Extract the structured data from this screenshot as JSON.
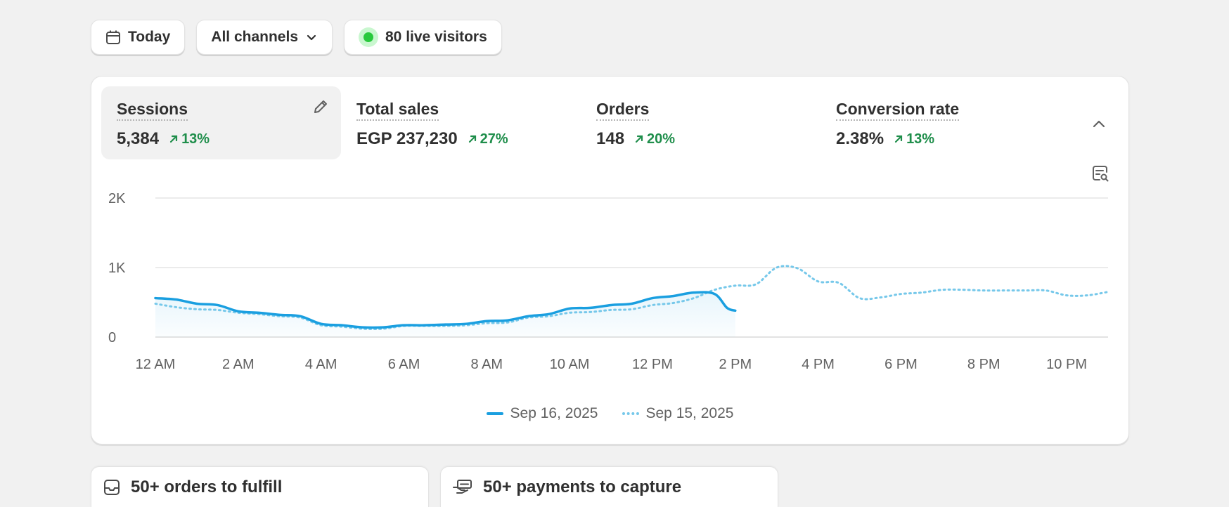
{
  "filters": {
    "date_label": "Today",
    "channel_label": "All channels",
    "live_visitors_label": "80 live visitors"
  },
  "metrics": [
    {
      "label": "Sessions",
      "value": "5,384",
      "change": "13%"
    },
    {
      "label": "Total sales",
      "value": "EGP 237,230",
      "change": "27%"
    },
    {
      "label": "Orders",
      "value": "148",
      "change": "20%"
    },
    {
      "label": "Conversion rate",
      "value": "2.38%",
      "change": "13%"
    }
  ],
  "colors": {
    "accent": "#1a9fe0",
    "comparison": "#76c8ea",
    "positive": "#1f8e4b",
    "live": "#29c93d"
  },
  "chart_data": {
    "type": "line",
    "y_ticks": [
      "2K",
      "1K",
      "0"
    ],
    "ylim": [
      0,
      2000
    ],
    "x_ticks": [
      "12 AM",
      "2 AM",
      "4 AM",
      "6 AM",
      "8 AM",
      "10 AM",
      "12 PM",
      "2 PM",
      "4 PM",
      "6 PM",
      "8 PM",
      "10 PM"
    ],
    "xlim": [
      0,
      23
    ],
    "grid": true,
    "legend_position": "bottom-center",
    "series": [
      {
        "name": "Sep 16, 2025",
        "style": "solid",
        "x": [
          0,
          0.5,
          1,
          1.5,
          2,
          2.5,
          3,
          3.5,
          4,
          4.5,
          5,
          5.5,
          6,
          6.5,
          7,
          7.5,
          8,
          8.5,
          9,
          9.5,
          10,
          10.5,
          11,
          11.5,
          12,
          12.5,
          13,
          13.5,
          13.8,
          14
        ],
        "values": [
          560,
          540,
          480,
          460,
          370,
          350,
          320,
          300,
          190,
          170,
          140,
          140,
          170,
          170,
          180,
          190,
          230,
          240,
          300,
          330,
          410,
          420,
          460,
          480,
          560,
          590,
          640,
          620,
          420,
          380
        ]
      },
      {
        "name": "Sep 15, 2025",
        "style": "dotted",
        "x": [
          0,
          0.5,
          1,
          1.5,
          2,
          2.5,
          3,
          3.5,
          4,
          4.5,
          5,
          5.5,
          6,
          6.5,
          7,
          7.5,
          8,
          8.5,
          9,
          9.5,
          10,
          10.5,
          11,
          11.5,
          12,
          12.5,
          13,
          13.5,
          14,
          14.5,
          15,
          15.5,
          16,
          16.5,
          17,
          17.5,
          18,
          18.5,
          19,
          19.5,
          20,
          20.5,
          21,
          21.5,
          22,
          22.5,
          23
        ],
        "values": [
          480,
          430,
          400,
          390,
          350,
          330,
          300,
          280,
          170,
          150,
          120,
          120,
          160,
          160,
          160,
          170,
          200,
          210,
          280,
          300,
          350,
          360,
          390,
          400,
          460,
          490,
          560,
          680,
          740,
          760,
          1000,
          990,
          800,
          780,
          560,
          570,
          620,
          640,
          680,
          680,
          670,
          670,
          670,
          670,
          600,
          600,
          650
        ]
      }
    ]
  },
  "tasks": [
    {
      "label": "50+ orders to fulfill"
    },
    {
      "label": "50+ payments to capture"
    }
  ]
}
